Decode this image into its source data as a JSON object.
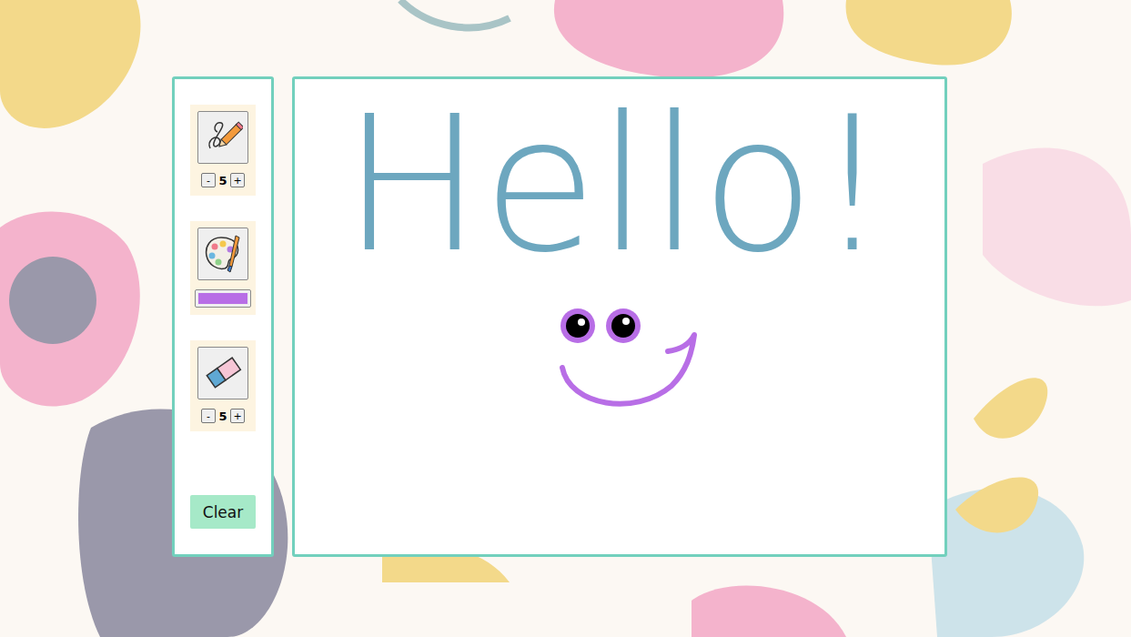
{
  "tools": [
    {
      "name": "pencil",
      "kind": "size",
      "minus": "-",
      "size": "5",
      "plus": "+"
    },
    {
      "name": "palette",
      "kind": "color",
      "color": "#b86ee6"
    },
    {
      "name": "eraser",
      "kind": "size",
      "minus": "-",
      "size": "5",
      "plus": "+"
    }
  ],
  "clear_button": "Clear",
  "canvas": {
    "handwriting": {
      "text": "Hello!",
      "color": "#6da7bf"
    },
    "smiley": {
      "color": "#b86ee6"
    }
  }
}
